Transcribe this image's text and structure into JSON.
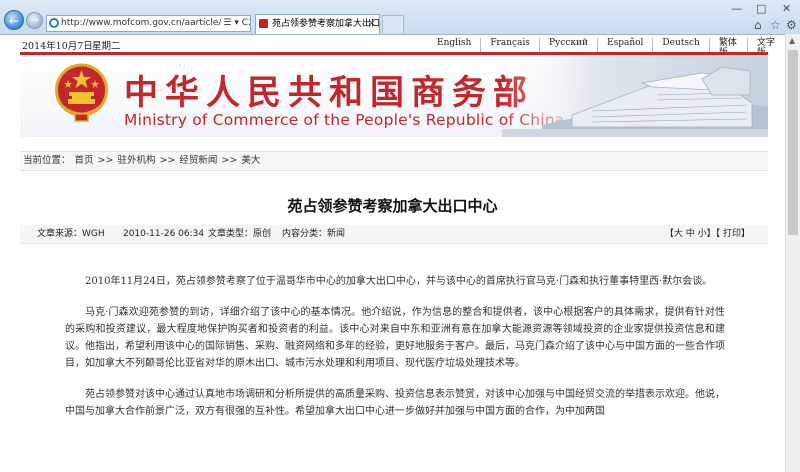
{
  "browser": {
    "url": "http://www.mofcom.gov.cn/aarticle/i/jyjl/l/201",
    "addr_tools": "☰ ▾ C",
    "tab_title": "苑占领参赞考察加拿大出口中心",
    "tab_close": "×",
    "back_glyph": "←",
    "forward_glyph": "→",
    "window_controls": {
      "min": "—",
      "max": "□",
      "close": "✕"
    },
    "toolbar_icons": [
      "home-icon",
      "star-icon",
      "gear-icon"
    ],
    "toolbar_glyphs": {
      "home": "⌂",
      "star": "☆",
      "gear": "⚙"
    }
  },
  "topbar": {
    "date": "2014年10月7日",
    "weekday": "星期二",
    "languages": [
      "English",
      "Français",
      "Pусский",
      "Español",
      "Deutsch",
      "繁体版",
      "文字版"
    ]
  },
  "banner": {
    "cn_title": "中华人民共和国商务部",
    "en_title": "Ministry of Commerce of the People's Republic of China",
    "colors": {
      "brand_red": "#c1272d",
      "gold": "#f2c230"
    }
  },
  "breadcrumb": {
    "label": "当前位置：",
    "items": [
      "首页",
      "驻外机构",
      "经贸新闻",
      "美大"
    ],
    "separator": ">>"
  },
  "article": {
    "title": "苑占领参赞考察加拿大出口中心",
    "meta": {
      "source": "文章来源：WGH",
      "date": "2010-11-26 06:34",
      "type": "文章类型：原创",
      "category": "内容分类：新闻",
      "tools": "【大 中 小】【 打印】"
    },
    "paragraphs": [
      "2010年11月24日，苑占领参赞考察了位于温哥华市中心的加拿大出口中心，并与该中心的首席执行官马克·门森和执行董事特里西·默尔会谈。",
      "马克·门森欢迎苑参赞的到访，详细介绍了该中心的基本情况。他介绍说，作为信息的整合和提供者，该中心根据客户的具体需求，提供有针对性的采购和投资建议，最大程度地保护购买者和投资者的利益。该中心对来自中东和亚洲有意在加拿大能源资源等领域投资的企业家提供投资信息和建议。他指出，希望利用该中心的国际销售、采购、融资网络和多年的经验，更好地服务于客户。最后，马克门森介绍了该中心与中国方面的一些合作项目，如加拿大不列颠哥伦比亚省对华的原木出口、城市污水处理和利用项目、现代医疗垃圾处理技术等。",
      "苑占领参赞对该中心通过认真地市场调研和分析所提供的高质量采购、投资信息表示赞赏，对该中心加强与中国经贸交流的举措表示欢迎。他说，中国与加拿大合作前景广泛，双方有很强的互补性。希望加拿大出口中心进一步做好并加强与中国方面的合作，为中加两国"
    ]
  }
}
